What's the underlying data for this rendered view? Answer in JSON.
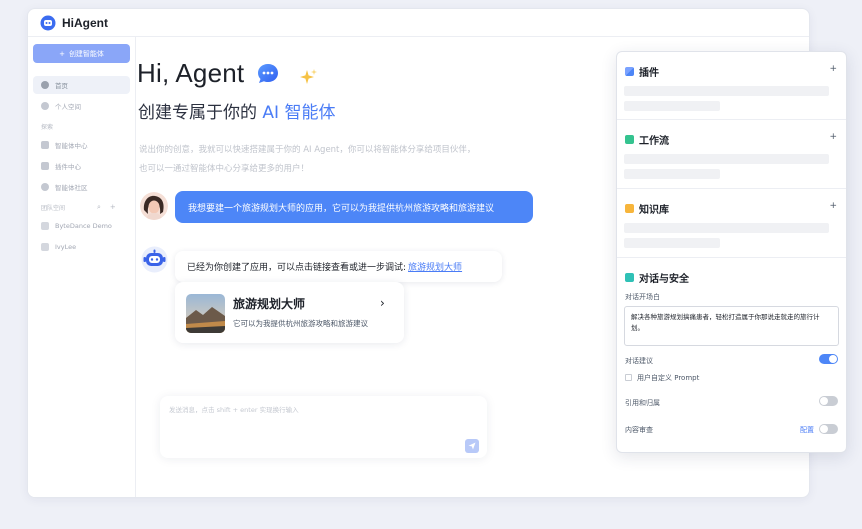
{
  "app": {
    "title": "HiAgent"
  },
  "sidebar": {
    "create_label": "创建智能体",
    "items": [
      {
        "label": "首页"
      },
      {
        "label": "个人空间"
      }
    ],
    "explore_label": "探索",
    "explore_items": [
      {
        "label": "智能体中心"
      },
      {
        "label": "插件中心"
      },
      {
        "label": "智能体社区"
      }
    ],
    "team_label": "团队空间",
    "team_tools": [
      "⌕",
      "+"
    ],
    "team_items": [
      {
        "label": "ByteDance Demo"
      },
      {
        "label": "IvyLee"
      }
    ]
  },
  "hero": {
    "title": "Hi, Agent",
    "subtitle_prefix": "创建专属于你的",
    "subtitle_accent": "AI 智能体",
    "desc_line1": "说出你的创意，我就可以快速搭建属于你的 AI Agent，你可以将智能体分享给项目伙伴，",
    "desc_line2": "也可以一通过智能体中心分享给更多的用户！"
  },
  "chat": {
    "user_message": "我想要建一个旅游规划大师的应用，它可以为我提供杭州旅游攻略和旅游建议",
    "bot_message": "已经为你创建了应用，可以点击链接查看或进一步调试:",
    "bot_link": "旅游规划大师",
    "card_title": "旅游规划大师",
    "card_desc": "它可以为我提供杭州旅游攻略和旅游建议",
    "card_arrow": "›"
  },
  "composer": {
    "placeholder": "发送消息，点击 shift + enter 实现换行输入"
  },
  "panel": {
    "plugins": {
      "title": "插件",
      "plus": "+"
    },
    "workflow": {
      "title": "工作流",
      "plus": "+"
    },
    "knowledge": {
      "title": "知识库",
      "plus": "+"
    },
    "safety": {
      "title": "对话与安全",
      "opening_label": "对话开场白",
      "opening_text": "解决各种旅游规划搞痛患者，轻松打造属于你那说走就走的旅行计划。",
      "suggest_label": "对话建议",
      "suggest_on": true,
      "custom_prompt_label": "用户自定义 Prompt",
      "citation_label": "引用和归属",
      "citation_on": false,
      "review_label": "内容审查",
      "review_link": "配置",
      "review_on": false
    }
  },
  "colors": {
    "accent": "#4d86f7",
    "create_button": "#8aa6f8"
  }
}
